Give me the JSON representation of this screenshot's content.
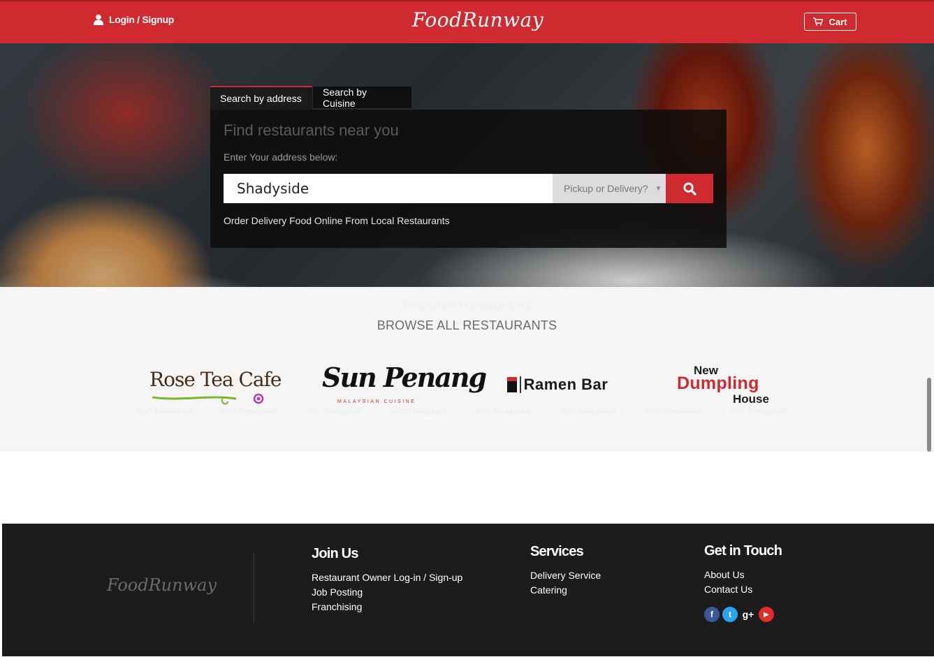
{
  "header": {
    "login_label": "Login / Signup",
    "brand": "FoodRunway",
    "cart_label": "Cart"
  },
  "search": {
    "tabs": [
      "Search by address",
      "Search by Cuisine"
    ],
    "heading": "Find restaurants near you",
    "instruction": "Enter Your address below:",
    "address_value": "Shadyside",
    "mode_select": "Pickup or Delivery?",
    "tagline": "Order Delivery Food Online From Local Restaurants"
  },
  "featured": {
    "title": "Featured Restaurants",
    "browse_label": "BROWSE ALL RESTAURANTS",
    "restaurants": [
      {
        "name": "Rose Tea Cafe"
      },
      {
        "name": "Sun Penang",
        "subtitle": "MALAYSIAN CUISINE"
      },
      {
        "name": "Ramen Bar"
      },
      {
        "name_top": "New",
        "name_mid": "Dumpling",
        "name_bot": "House"
      }
    ],
    "ghost_labels": [
      "ABC Restaurant",
      "ABC Restaurant",
      "ABC Restaurant",
      "ABC Restaurant",
      "ABC Restaurant",
      "ABC Restaurant",
      "ABC Restaurant",
      "ABC Restaurant"
    ]
  },
  "footer": {
    "brand": "FoodRunway",
    "join": {
      "heading": "Join Us",
      "links": [
        "Restaurant Owner Log-in / Sign-up",
        "Job Posting",
        "Franchising"
      ]
    },
    "services": {
      "heading": "Services",
      "links": [
        "Delivery Service",
        "Catering"
      ]
    },
    "contact": {
      "heading": "Get in Touch",
      "links": [
        "About Us",
        "Contact Us"
      ],
      "social": [
        {
          "icon": "facebook-icon",
          "glyph": "f",
          "color": "#3b5998"
        },
        {
          "icon": "twitter-icon",
          "glyph": "t",
          "color": "#2aa3ef"
        },
        {
          "icon": "google-plus-icon",
          "glyph": "g+",
          "color": "#1c1c1c"
        },
        {
          "icon": "youtube-icon",
          "glyph": "▶",
          "color": "#e52d27"
        }
      ]
    }
  },
  "colors": {
    "brand_red": "#cf2a2f",
    "footer_bg": "#1c1c1c"
  }
}
